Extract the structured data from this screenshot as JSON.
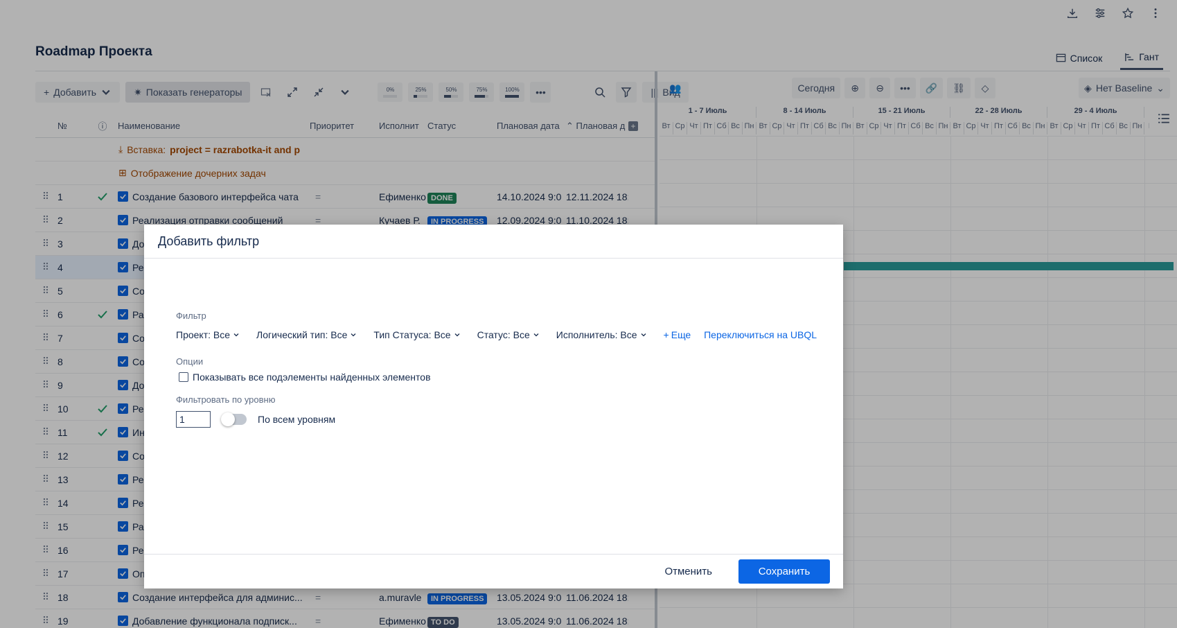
{
  "page": {
    "title": "Roadmap Проекта"
  },
  "views": {
    "list": "Список",
    "gantt": "Гант"
  },
  "toolbar": {
    "add": "Добавить",
    "generators": "Показать генераторы",
    "percents": [
      {
        "label": "0%",
        "fill": 0
      },
      {
        "label": "25%",
        "fill": 25
      },
      {
        "label": "50%",
        "fill": 50
      },
      {
        "label": "75%",
        "fill": 75
      },
      {
        "label": "100%",
        "fill": 100
      }
    ],
    "view": "Вид"
  },
  "table": {
    "headers": {
      "num": "№",
      "name": "Наименование",
      "priority": "Приоритет",
      "executor": "Исполнит",
      "status": "Статус",
      "plan_start": "Плановая дата",
      "plan_end": "Плановая д"
    },
    "insert_row": {
      "prefix": "Вставка:",
      "query": "project = razrabotka-it and p"
    },
    "children_row": {
      "label": "Отображение дочерних задач"
    },
    "rows": [
      {
        "num": "1",
        "done": true,
        "name": "Создание базового интерфейса чата",
        "priority": "=",
        "executor": "Ефименко",
        "status": "DONE",
        "status_kind": "done",
        "d1": "14.10.2024 9:0",
        "d2": "12.11.2024 18:"
      },
      {
        "num": "2",
        "done": false,
        "name": "Реализация отправки сообщений",
        "priority": "=",
        "executor": "Кучаев Р.",
        "status": "IN PROGRESS",
        "status_kind": "prog",
        "d1": "12.09.2024 9:0",
        "d2": "11.10.2024 18:"
      },
      {
        "num": "3",
        "done": false,
        "name": "До",
        "priority": "",
        "executor": "",
        "status": "",
        "status_kind": "",
        "d1": "",
        "d2": ""
      },
      {
        "num": "4",
        "done": false,
        "name": "Ре",
        "priority": "",
        "executor": "",
        "status": "",
        "status_kind": "",
        "d1": "",
        "d2": ""
      },
      {
        "num": "5",
        "done": false,
        "name": "Со",
        "priority": "",
        "executor": "",
        "status": "",
        "status_kind": "",
        "d1": "",
        "d2": ""
      },
      {
        "num": "6",
        "done": true,
        "name": "Ра",
        "priority": "",
        "executor": "",
        "status": "",
        "status_kind": "",
        "d1": "",
        "d2": ""
      },
      {
        "num": "7",
        "done": false,
        "name": "Со",
        "priority": "",
        "executor": "",
        "status": "",
        "status_kind": "",
        "d1": "",
        "d2": ""
      },
      {
        "num": "8",
        "done": false,
        "name": "Со",
        "priority": "",
        "executor": "",
        "status": "",
        "status_kind": "",
        "d1": "",
        "d2": ""
      },
      {
        "num": "9",
        "done": false,
        "name": "До",
        "priority": "",
        "executor": "",
        "status": "",
        "status_kind": "",
        "d1": "",
        "d2": ""
      },
      {
        "num": "10",
        "done": true,
        "name": "Ре",
        "priority": "",
        "executor": "",
        "status": "",
        "status_kind": "",
        "d1": "",
        "d2": ""
      },
      {
        "num": "11",
        "done": true,
        "name": "Ин",
        "priority": "",
        "executor": "",
        "status": "",
        "status_kind": "",
        "d1": "",
        "d2": ""
      },
      {
        "num": "12",
        "done": false,
        "name": "Со",
        "priority": "",
        "executor": "",
        "status": "",
        "status_kind": "",
        "d1": "",
        "d2": ""
      },
      {
        "num": "13",
        "done": false,
        "name": "Ре",
        "priority": "",
        "executor": "",
        "status": "",
        "status_kind": "",
        "d1": "",
        "d2": ""
      },
      {
        "num": "14",
        "done": false,
        "name": "Ре",
        "priority": "",
        "executor": "",
        "status": "",
        "status_kind": "",
        "d1": "",
        "d2": ""
      },
      {
        "num": "15",
        "done": false,
        "name": "Ра",
        "priority": "",
        "executor": "",
        "status": "",
        "status_kind": "",
        "d1": "",
        "d2": ""
      },
      {
        "num": "16",
        "done": false,
        "name": "Ре",
        "priority": "",
        "executor": "",
        "status": "",
        "status_kind": "",
        "d1": "",
        "d2": ""
      },
      {
        "num": "17",
        "done": false,
        "name": "Оп",
        "priority": "",
        "executor": "",
        "status": "",
        "status_kind": "",
        "d1": "",
        "d2": ""
      },
      {
        "num": "18",
        "done": false,
        "name": "Создание интерфейса для админис...",
        "priority": "=",
        "executor": "a.muravle",
        "status": "IN PROGRESS",
        "status_kind": "prog",
        "d1": "13.05.2024 9:0",
        "d2": "11.06.2024 18:"
      },
      {
        "num": "19",
        "done": false,
        "name": "Добавление функционала подписк...",
        "priority": "=",
        "executor": "Ефименко",
        "status": "TO DO",
        "status_kind": "todo",
        "d1": "13.05.2024 9:0",
        "d2": "11.06.2024 18:"
      }
    ]
  },
  "gantt": {
    "today": "Сегодня",
    "baseline": "Нет Baseline",
    "weeks": [
      "1 - 7 Июль",
      "8 - 14 Июль",
      "15 - 21 Июль",
      "22 - 28 Июль",
      "29 - 4 Июль"
    ],
    "days": [
      "Вт",
      "Ср",
      "Чт",
      "Пт",
      "Сб",
      "Вс",
      "Пн",
      "Вт",
      "Ср",
      "Чт",
      "Пт",
      "Сб",
      "Вс",
      "Пн",
      "Вт",
      "Ср",
      "Чт",
      "Пт",
      "Сб",
      "Вс",
      "Пн",
      "Вт",
      "Ср",
      "Чт",
      "Пт",
      "Сб",
      "Вс",
      "Пн",
      "Вт",
      "Ср",
      "Чт",
      "Пт",
      "Сб",
      "Вс",
      "Пн",
      "В"
    ],
    "bar_color": "#2a9d9b"
  },
  "modal": {
    "title": "Добавить фильтр",
    "filter_label": "Фильтр",
    "filters": [
      "Проект: Все",
      "Логический тип: Все",
      "Тип Статуса: Все",
      "Статус: Все",
      "Исполнитель: Все"
    ],
    "more": "Еще",
    "ubql": "Переключиться на UBQL",
    "options_label": "Опции",
    "option_show_sub": "Показывать все подэлементы найденных элементов",
    "level_label": "Фильтровать по уровню",
    "level_value": "1",
    "all_levels": "По всем уровням",
    "cancel": "Отменить",
    "save": "Сохранить"
  }
}
